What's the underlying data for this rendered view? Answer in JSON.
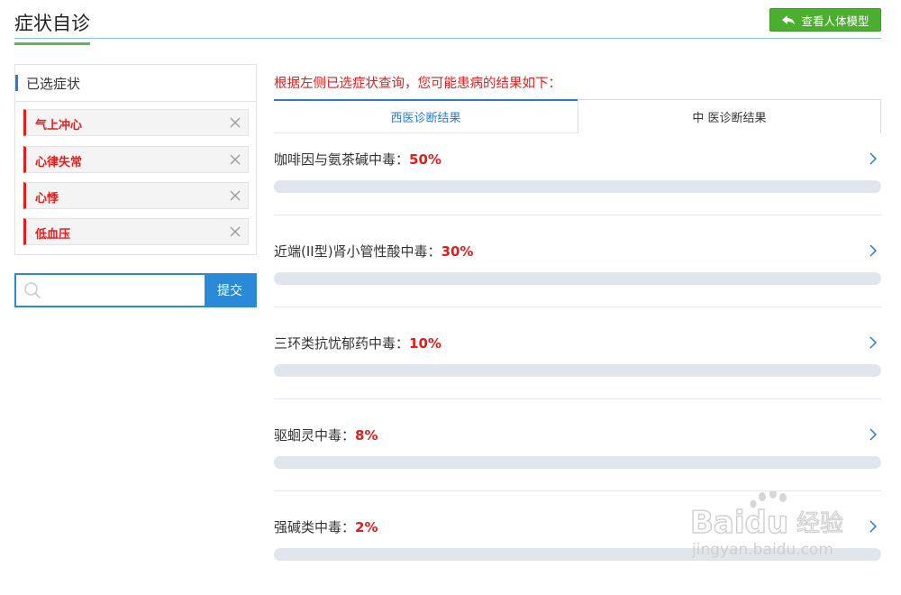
{
  "header": {
    "title": "症状自诊",
    "body_model_button": "查看人体模型"
  },
  "symptoms": {
    "title": "已选症状",
    "items": [
      {
        "label": "气上冲心"
      },
      {
        "label": "心律失常"
      },
      {
        "label": "心悸"
      },
      {
        "label": "低血压"
      }
    ]
  },
  "search": {
    "placeholder": "",
    "value": "",
    "submit_label": "提交"
  },
  "results": {
    "intro": "根据左侧已选症状查询，您可能患病的结果如下：",
    "tabs": [
      {
        "label": "西医诊断结果",
        "active": true
      },
      {
        "label": "中 医诊断结果",
        "active": false
      }
    ],
    "items": [
      {
        "name": "咖啡因与氨茶碱中毒：",
        "percent": "50%",
        "level": 0.5
      },
      {
        "name": "近端(II型)肾小管性酸中毒：",
        "percent": "30%",
        "level": 0.3
      },
      {
        "name": "三环类抗忧郁药中毒：",
        "percent": "10%",
        "level": 0.1
      },
      {
        "name": "驱蛔灵中毒：",
        "percent": "8%",
        "level": 0.08
      },
      {
        "name": "强碱类中毒：",
        "percent": "2%",
        "level": 0.02
      }
    ]
  },
  "watermark": {
    "brand": "Baidu",
    "brand_cn": "经验",
    "url": "jingyan.baidu.com"
  },
  "colors": {
    "accent": "#2b8ad8",
    "danger": "#e41c1c",
    "green_button": "#4cae2e",
    "track": "#e1e6ec"
  }
}
